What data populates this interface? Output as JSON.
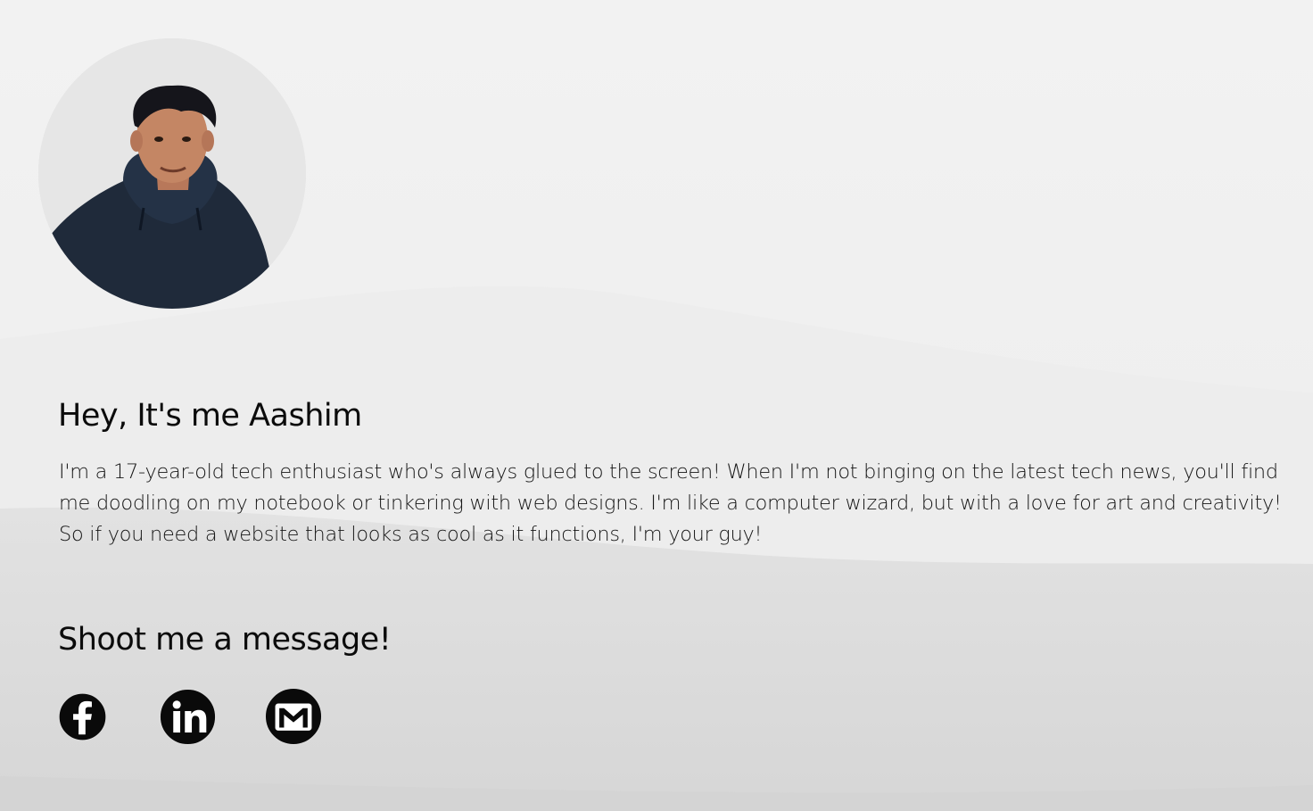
{
  "profile": {
    "avatar_alt": "Aashim",
    "greeting": "Hey, It's me Aashim",
    "bio": "I'm a 17-year-old tech enthusiast who's always glued to the screen! When I'm not binging on the latest tech news, you'll find me doodling on my notebook or tinkering with web designs. I'm like a computer wizard, but with a love for art and creativity! So if you need a website that looks as cool as it functions, I'm your guy!"
  },
  "contact": {
    "title": "Shoot me a message!",
    "links": [
      {
        "name": "Facebook",
        "icon": "facebook-icon"
      },
      {
        "name": "LinkedIn",
        "icon": "linkedin-icon"
      },
      {
        "name": "Gmail",
        "icon": "gmail-icon"
      }
    ]
  },
  "colors": {
    "background": "#f0f0f0",
    "text": "#111111",
    "icon": "#000000"
  }
}
